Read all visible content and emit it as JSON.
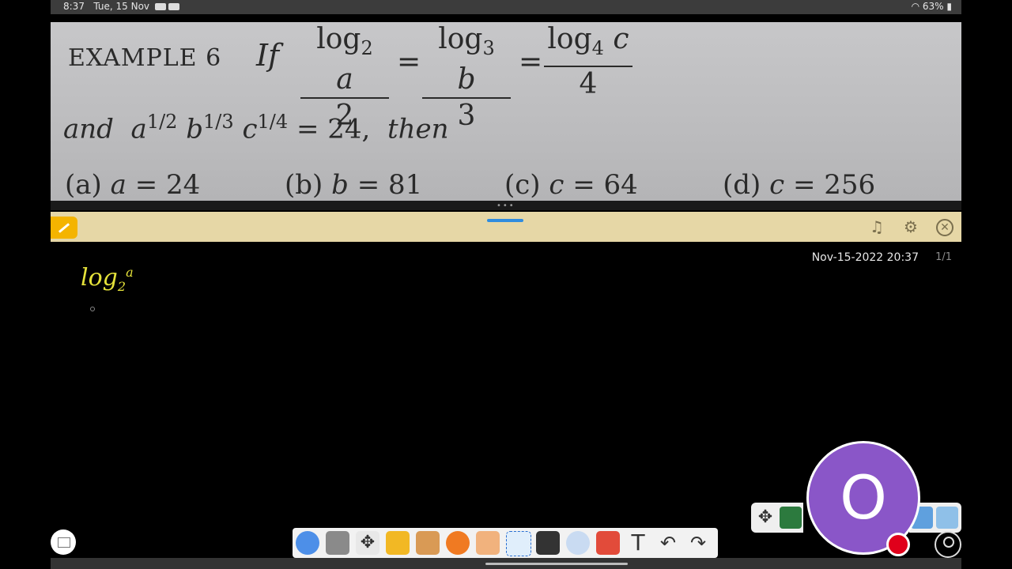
{
  "statusbar": {
    "time": "8:37",
    "date": "Tue, 15 Nov",
    "battery": "63%"
  },
  "problem": {
    "label": "EXAMPLE 6",
    "if_word": "If",
    "fractions": [
      {
        "log_base": "2",
        "var": "a",
        "den": "2"
      },
      {
        "log_base": "3",
        "var": "b",
        "den": "3"
      },
      {
        "log_base": "4",
        "var": "c",
        "den": "4"
      }
    ],
    "condition": {
      "and": "and",
      "a_exp": "1/2",
      "b_exp": "1/3",
      "c_exp": "1/4",
      "rhs": "= 24,",
      "then": "then"
    },
    "options": [
      {
        "label": "(a)",
        "var": "a",
        "value": "= 24"
      },
      {
        "label": "(b)",
        "var": "b",
        "value": "= 81"
      },
      {
        "label": "(c)",
        "var": "c",
        "value": "= 64"
      },
      {
        "label": "(d)",
        "var": "c",
        "value": "= 256"
      }
    ]
  },
  "board": {
    "timestamp": "Nov-15-2022 20:37",
    "page": "1/1",
    "ink_main": "log",
    "ink_sub": "2",
    "ink_sup": "a"
  },
  "participant": {
    "initial": "O"
  },
  "colors": {
    "toolbar": "#e6d7a6",
    "avatar": "#8a56c8",
    "ink": "#e5e23a",
    "record": "#e0001b",
    "handle": "#2f8cdf"
  },
  "dock_tools": [
    "participants-icon",
    "screenshot-icon",
    "move-icon",
    "folder-icon",
    "box-icon",
    "browser-icon",
    "hand-icon",
    "select-icon",
    "highlighter-icon",
    "magnifier-icon",
    "shapes-icon",
    "text-icon",
    "undo-icon",
    "redo-icon"
  ],
  "side_tools": [
    "move-icon",
    "board-icon",
    "cloud-icon",
    "window-icon"
  ]
}
